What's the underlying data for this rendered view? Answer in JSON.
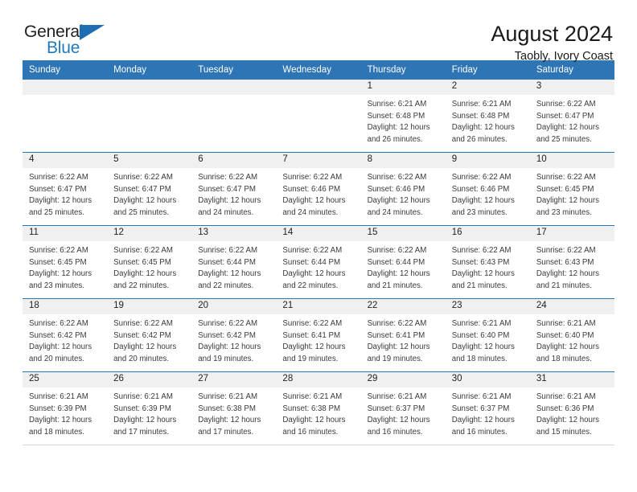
{
  "logo": {
    "word_one": "General",
    "word_two": "Blue",
    "triangle_color": "#1f6eb4"
  },
  "header": {
    "title": "August 2024",
    "subtitle": "Taobly, Ivory Coast"
  },
  "theme": {
    "header_blue": "#2e75b6",
    "daynum_gray": "#f0f0f0",
    "text_color": "#3a3a3a"
  },
  "calendar": {
    "weekday_headers": [
      "Sunday",
      "Monday",
      "Tuesday",
      "Wednesday",
      "Thursday",
      "Friday",
      "Saturday"
    ],
    "weeks": [
      [
        {
          "day": "",
          "sunrise": "",
          "sunset": "",
          "daylight_1": "",
          "daylight_2": ""
        },
        {
          "day": "",
          "sunrise": "",
          "sunset": "",
          "daylight_1": "",
          "daylight_2": ""
        },
        {
          "day": "",
          "sunrise": "",
          "sunset": "",
          "daylight_1": "",
          "daylight_2": ""
        },
        {
          "day": "",
          "sunrise": "",
          "sunset": "",
          "daylight_1": "",
          "daylight_2": ""
        },
        {
          "day": "1",
          "sunrise": "Sunrise: 6:21 AM",
          "sunset": "Sunset: 6:48 PM",
          "daylight_1": "Daylight: 12 hours",
          "daylight_2": "and 26 minutes."
        },
        {
          "day": "2",
          "sunrise": "Sunrise: 6:21 AM",
          "sunset": "Sunset: 6:48 PM",
          "daylight_1": "Daylight: 12 hours",
          "daylight_2": "and 26 minutes."
        },
        {
          "day": "3",
          "sunrise": "Sunrise: 6:22 AM",
          "sunset": "Sunset: 6:47 PM",
          "daylight_1": "Daylight: 12 hours",
          "daylight_2": "and 25 minutes."
        }
      ],
      [
        {
          "day": "4",
          "sunrise": "Sunrise: 6:22 AM",
          "sunset": "Sunset: 6:47 PM",
          "daylight_1": "Daylight: 12 hours",
          "daylight_2": "and 25 minutes."
        },
        {
          "day": "5",
          "sunrise": "Sunrise: 6:22 AM",
          "sunset": "Sunset: 6:47 PM",
          "daylight_1": "Daylight: 12 hours",
          "daylight_2": "and 25 minutes."
        },
        {
          "day": "6",
          "sunrise": "Sunrise: 6:22 AM",
          "sunset": "Sunset: 6:47 PM",
          "daylight_1": "Daylight: 12 hours",
          "daylight_2": "and 24 minutes."
        },
        {
          "day": "7",
          "sunrise": "Sunrise: 6:22 AM",
          "sunset": "Sunset: 6:46 PM",
          "daylight_1": "Daylight: 12 hours",
          "daylight_2": "and 24 minutes."
        },
        {
          "day": "8",
          "sunrise": "Sunrise: 6:22 AM",
          "sunset": "Sunset: 6:46 PM",
          "daylight_1": "Daylight: 12 hours",
          "daylight_2": "and 24 minutes."
        },
        {
          "day": "9",
          "sunrise": "Sunrise: 6:22 AM",
          "sunset": "Sunset: 6:46 PM",
          "daylight_1": "Daylight: 12 hours",
          "daylight_2": "and 23 minutes."
        },
        {
          "day": "10",
          "sunrise": "Sunrise: 6:22 AM",
          "sunset": "Sunset: 6:45 PM",
          "daylight_1": "Daylight: 12 hours",
          "daylight_2": "and 23 minutes."
        }
      ],
      [
        {
          "day": "11",
          "sunrise": "Sunrise: 6:22 AM",
          "sunset": "Sunset: 6:45 PM",
          "daylight_1": "Daylight: 12 hours",
          "daylight_2": "and 23 minutes."
        },
        {
          "day": "12",
          "sunrise": "Sunrise: 6:22 AM",
          "sunset": "Sunset: 6:45 PM",
          "daylight_1": "Daylight: 12 hours",
          "daylight_2": "and 22 minutes."
        },
        {
          "day": "13",
          "sunrise": "Sunrise: 6:22 AM",
          "sunset": "Sunset: 6:44 PM",
          "daylight_1": "Daylight: 12 hours",
          "daylight_2": "and 22 minutes."
        },
        {
          "day": "14",
          "sunrise": "Sunrise: 6:22 AM",
          "sunset": "Sunset: 6:44 PM",
          "daylight_1": "Daylight: 12 hours",
          "daylight_2": "and 22 minutes."
        },
        {
          "day": "15",
          "sunrise": "Sunrise: 6:22 AM",
          "sunset": "Sunset: 6:44 PM",
          "daylight_1": "Daylight: 12 hours",
          "daylight_2": "and 21 minutes."
        },
        {
          "day": "16",
          "sunrise": "Sunrise: 6:22 AM",
          "sunset": "Sunset: 6:43 PM",
          "daylight_1": "Daylight: 12 hours",
          "daylight_2": "and 21 minutes."
        },
        {
          "day": "17",
          "sunrise": "Sunrise: 6:22 AM",
          "sunset": "Sunset: 6:43 PM",
          "daylight_1": "Daylight: 12 hours",
          "daylight_2": "and 21 minutes."
        }
      ],
      [
        {
          "day": "18",
          "sunrise": "Sunrise: 6:22 AM",
          "sunset": "Sunset: 6:42 PM",
          "daylight_1": "Daylight: 12 hours",
          "daylight_2": "and 20 minutes."
        },
        {
          "day": "19",
          "sunrise": "Sunrise: 6:22 AM",
          "sunset": "Sunset: 6:42 PM",
          "daylight_1": "Daylight: 12 hours",
          "daylight_2": "and 20 minutes."
        },
        {
          "day": "20",
          "sunrise": "Sunrise: 6:22 AM",
          "sunset": "Sunset: 6:42 PM",
          "daylight_1": "Daylight: 12 hours",
          "daylight_2": "and 19 minutes."
        },
        {
          "day": "21",
          "sunrise": "Sunrise: 6:22 AM",
          "sunset": "Sunset: 6:41 PM",
          "daylight_1": "Daylight: 12 hours",
          "daylight_2": "and 19 minutes."
        },
        {
          "day": "22",
          "sunrise": "Sunrise: 6:22 AM",
          "sunset": "Sunset: 6:41 PM",
          "daylight_1": "Daylight: 12 hours",
          "daylight_2": "and 19 minutes."
        },
        {
          "day": "23",
          "sunrise": "Sunrise: 6:21 AM",
          "sunset": "Sunset: 6:40 PM",
          "daylight_1": "Daylight: 12 hours",
          "daylight_2": "and 18 minutes."
        },
        {
          "day": "24",
          "sunrise": "Sunrise: 6:21 AM",
          "sunset": "Sunset: 6:40 PM",
          "daylight_1": "Daylight: 12 hours",
          "daylight_2": "and 18 minutes."
        }
      ],
      [
        {
          "day": "25",
          "sunrise": "Sunrise: 6:21 AM",
          "sunset": "Sunset: 6:39 PM",
          "daylight_1": "Daylight: 12 hours",
          "daylight_2": "and 18 minutes."
        },
        {
          "day": "26",
          "sunrise": "Sunrise: 6:21 AM",
          "sunset": "Sunset: 6:39 PM",
          "daylight_1": "Daylight: 12 hours",
          "daylight_2": "and 17 minutes."
        },
        {
          "day": "27",
          "sunrise": "Sunrise: 6:21 AM",
          "sunset": "Sunset: 6:38 PM",
          "daylight_1": "Daylight: 12 hours",
          "daylight_2": "and 17 minutes."
        },
        {
          "day": "28",
          "sunrise": "Sunrise: 6:21 AM",
          "sunset": "Sunset: 6:38 PM",
          "daylight_1": "Daylight: 12 hours",
          "daylight_2": "and 16 minutes."
        },
        {
          "day": "29",
          "sunrise": "Sunrise: 6:21 AM",
          "sunset": "Sunset: 6:37 PM",
          "daylight_1": "Daylight: 12 hours",
          "daylight_2": "and 16 minutes."
        },
        {
          "day": "30",
          "sunrise": "Sunrise: 6:21 AM",
          "sunset": "Sunset: 6:37 PM",
          "daylight_1": "Daylight: 12 hours",
          "daylight_2": "and 16 minutes."
        },
        {
          "day": "31",
          "sunrise": "Sunrise: 6:21 AM",
          "sunset": "Sunset: 6:36 PM",
          "daylight_1": "Daylight: 12 hours",
          "daylight_2": "and 15 minutes."
        }
      ]
    ]
  }
}
